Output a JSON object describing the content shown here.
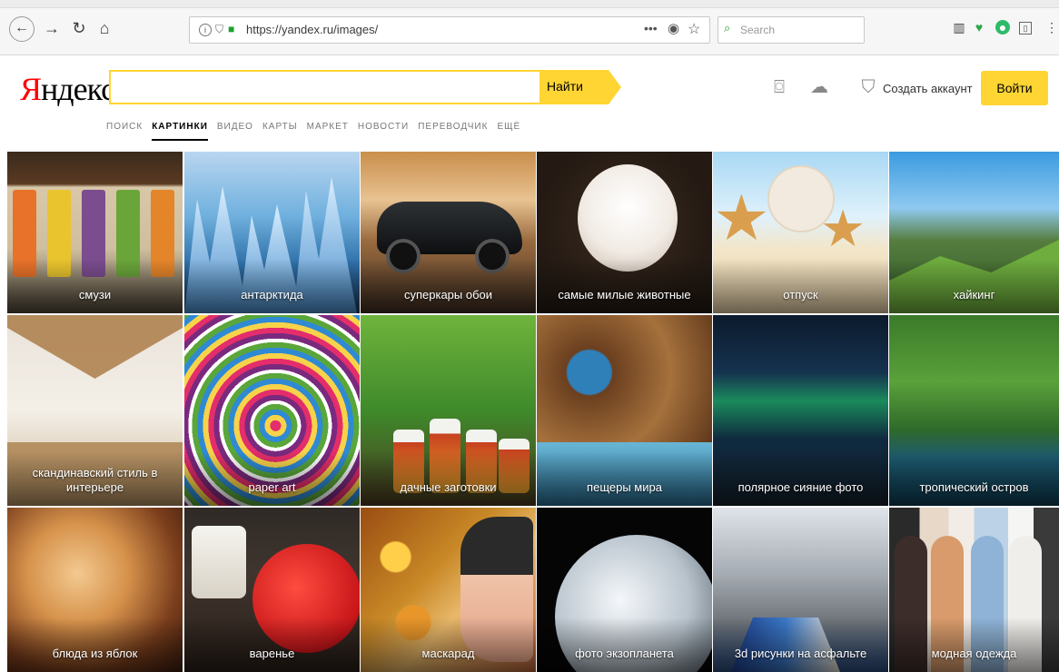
{
  "browser": {
    "url": "https://yandex.ru/images/",
    "search_placeholder": "Search",
    "icons": [
      "back-icon",
      "forward-icon",
      "reload-icon",
      "home-icon",
      "info-icon",
      "shield-icon",
      "lock-icon",
      "more-icon",
      "pocket-icon",
      "star-icon",
      "library-icon",
      "plugin-icon",
      "extension-icon",
      "sidebar-icon",
      "menu-icon"
    ]
  },
  "header": {
    "logo_first": "Я",
    "logo_rest": "ндекс",
    "search_value": "",
    "search_button": "Найти",
    "create_account": "Создать аккаунт",
    "login": "Войти"
  },
  "services": [
    {
      "label": "ПОИСК",
      "active": false
    },
    {
      "label": "КАРТИНКИ",
      "active": true
    },
    {
      "label": "ВИДЕО",
      "active": false
    },
    {
      "label": "КАРТЫ",
      "active": false
    },
    {
      "label": "МАРКЕТ",
      "active": false
    },
    {
      "label": "НОВОСТИ",
      "active": false
    },
    {
      "label": "ПЕРЕВОДЧИК",
      "active": false
    },
    {
      "label": "ЕЩЁ",
      "active": false
    }
  ],
  "tiles": [
    {
      "caption": "смузи"
    },
    {
      "caption": "антарктида"
    },
    {
      "caption": "суперкары обои"
    },
    {
      "caption": "самые милые животные"
    },
    {
      "caption": "отпуск"
    },
    {
      "caption": "хайкинг"
    },
    {
      "caption": "скандинавский стиль в интерьере"
    },
    {
      "caption": "paper art"
    },
    {
      "caption": "дачные заготовки"
    },
    {
      "caption": "пещеры мира"
    },
    {
      "caption": "полярное сияние фото"
    },
    {
      "caption": "тропический остров"
    },
    {
      "caption": "блюда из яблок"
    },
    {
      "caption": "варенье"
    },
    {
      "caption": "маскарад"
    },
    {
      "caption": "фото экзопланета"
    },
    {
      "caption": "3d рисунки на асфальте"
    },
    {
      "caption": "модная одежда"
    }
  ],
  "colors": {
    "accent": "#ffd533",
    "logo_red": "#ff0000"
  }
}
